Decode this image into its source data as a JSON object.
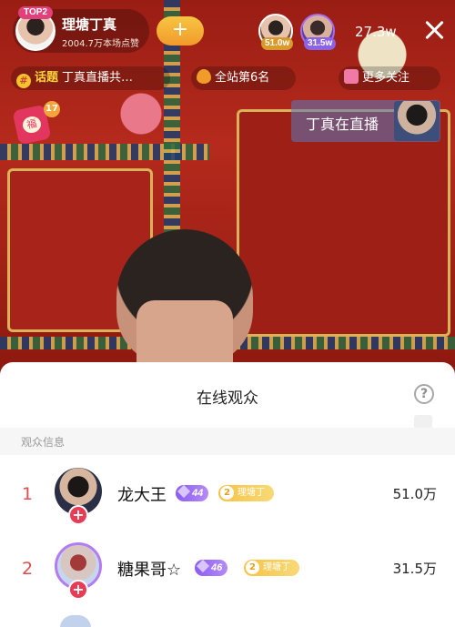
{
  "host": {
    "badge": "TOP2",
    "name": "理塘丁真",
    "likes": "2004.7万本场点赞",
    "follow_symbol": "+"
  },
  "top_viewers": [
    {
      "score": "51.0w"
    },
    {
      "score": "31.5w"
    }
  ],
  "online_count": "27.3w",
  "chips": {
    "topic_tag": "话题",
    "topic_text": "丁真直播共…",
    "rank_text": "全站第6名",
    "more_text": "更多关注"
  },
  "red_packet": {
    "label": "福",
    "count": "17"
  },
  "live_card": {
    "text": "丁真在直播"
  },
  "sheet": {
    "title": "在线观众",
    "help": "?",
    "section_label": "观众信息"
  },
  "audience": [
    {
      "rank": "1",
      "name": "龙大王",
      "level": "44",
      "fan_level": "2",
      "fan_name": "理塘丁",
      "score": "51.0万",
      "add": "+"
    },
    {
      "rank": "2",
      "name": "糖果哥☆",
      "level": "46",
      "fan_level": "2",
      "fan_name": "理塘丁",
      "score": "31.5万",
      "add": "+"
    }
  ],
  "colors": {
    "rank_red": "#e24c4c",
    "follow_orange": "#f19b2a",
    "level_purple": "#8b5cf0",
    "fan_gold": "#f6c343"
  },
  "icons": [
    "close-icon",
    "topic-icon",
    "flame-icon",
    "chart-icon",
    "help-icon",
    "plus-icon",
    "gem-icon"
  ]
}
